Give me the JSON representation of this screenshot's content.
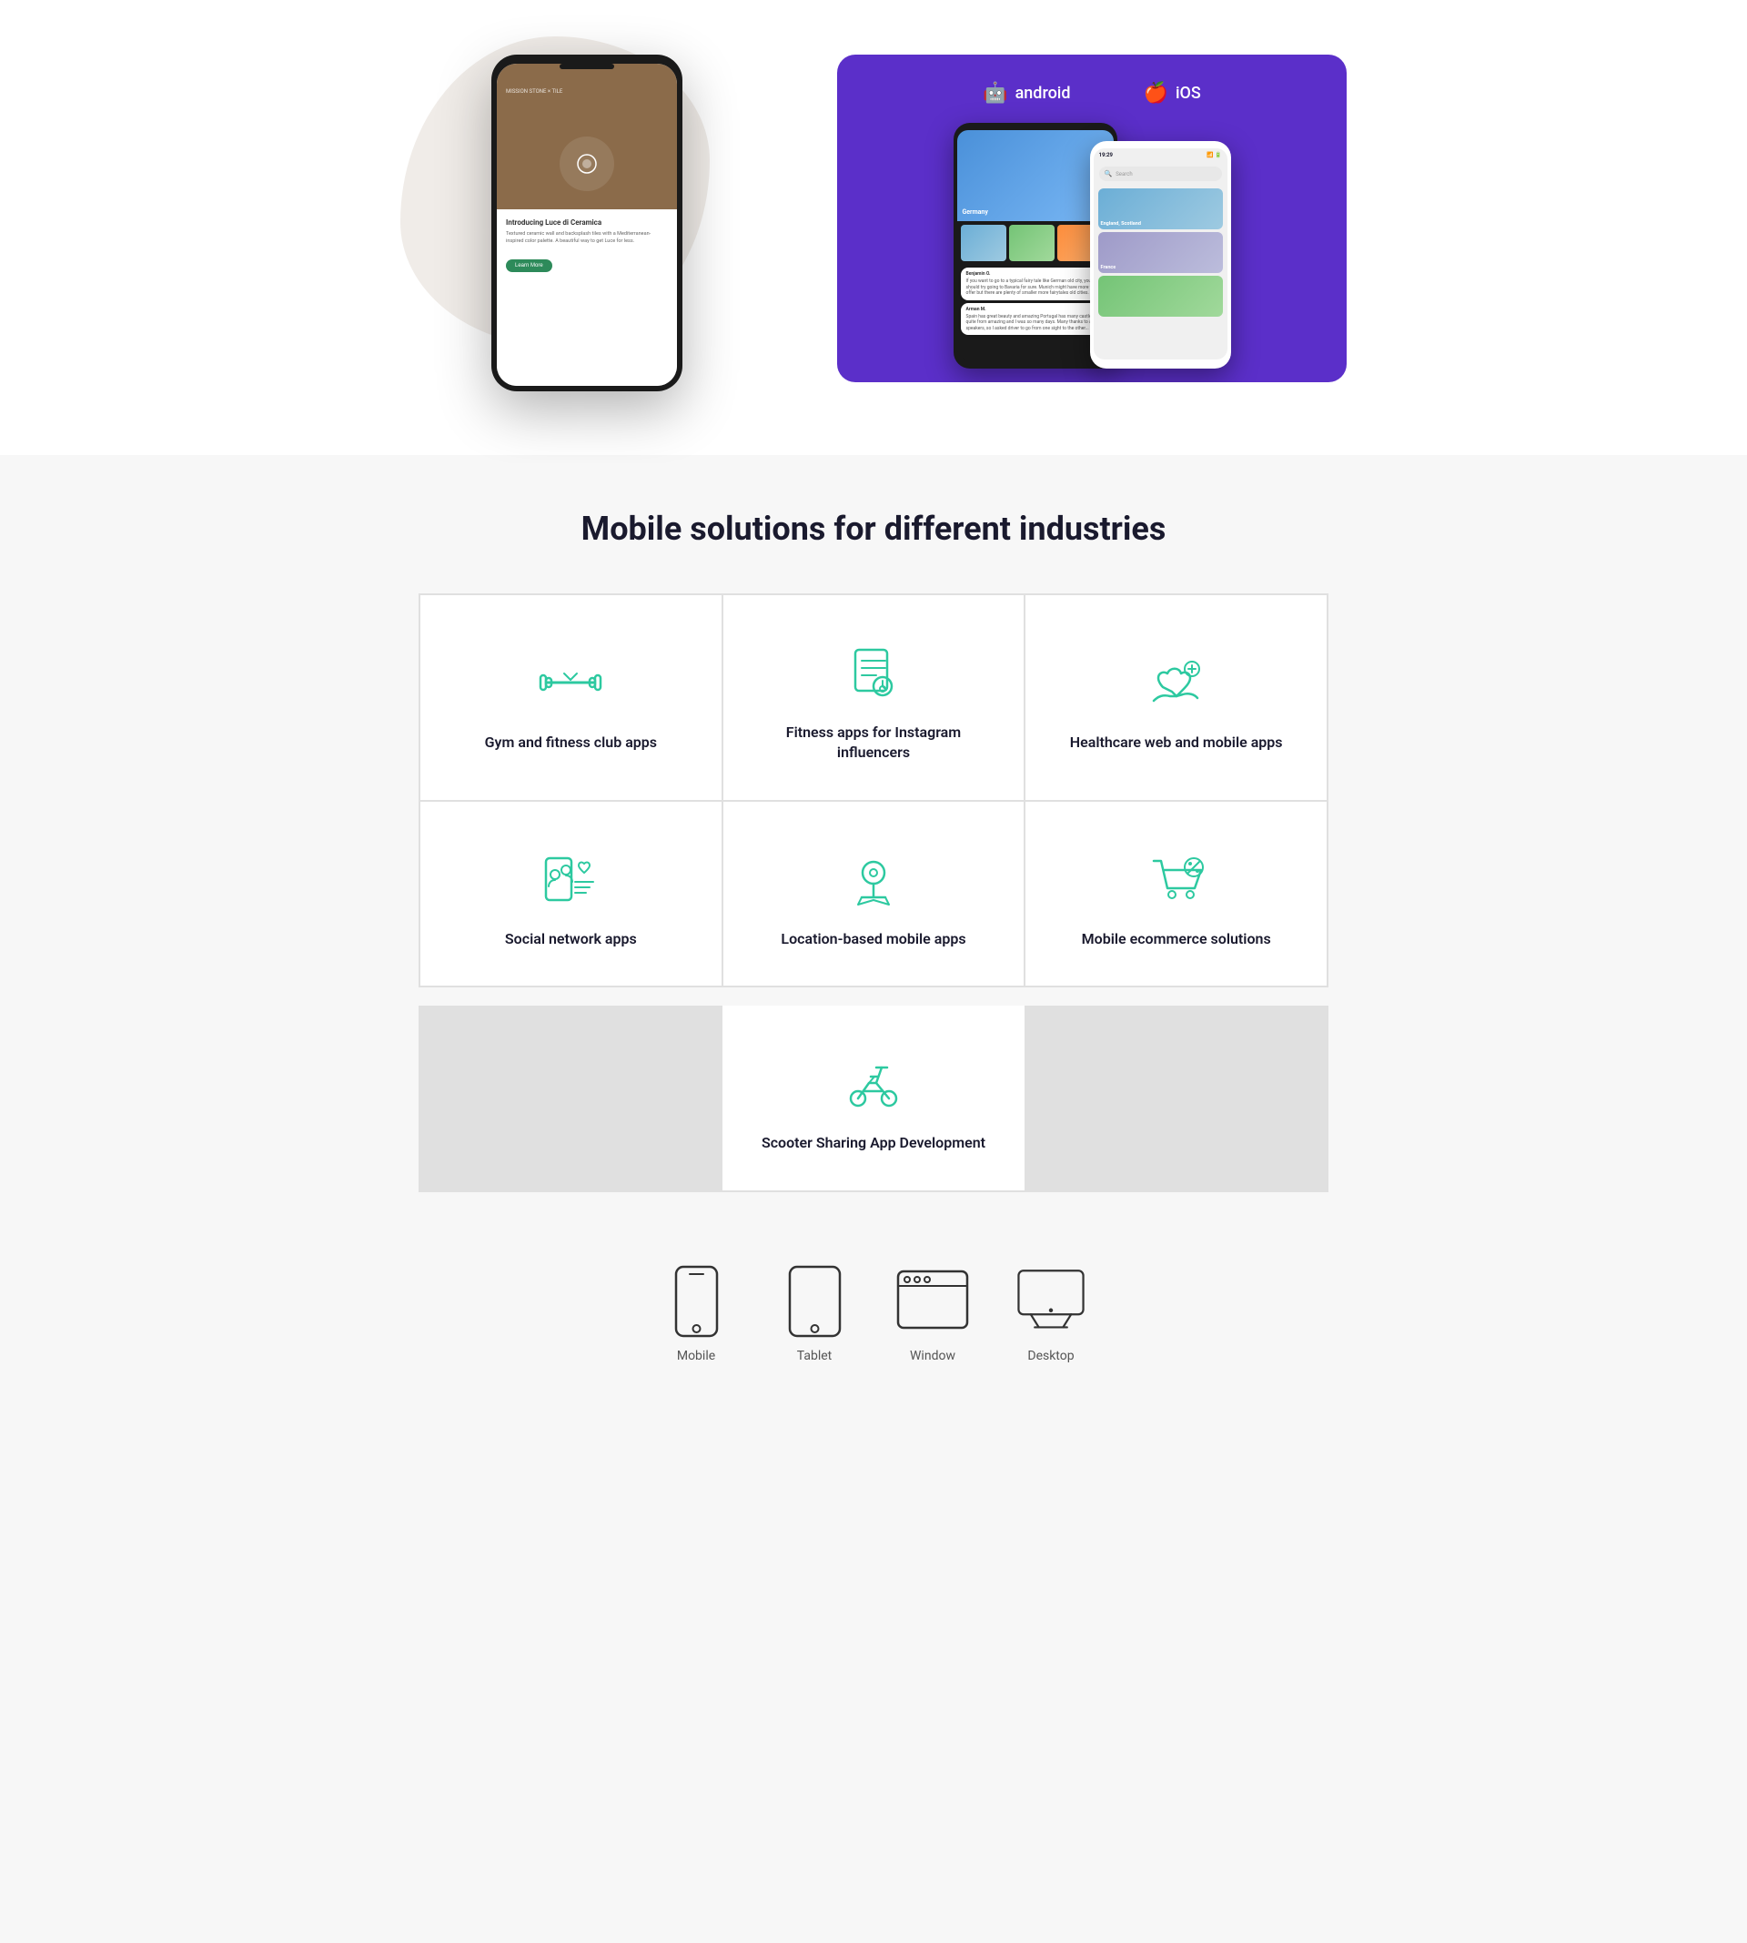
{
  "hero": {
    "phone_content_title": "Introducing Luce di Ceramica",
    "phone_content_text": "Textured ceramic wall and backsplash tiles with a Mediterranean-inspired color palette. A beautiful way to get Luce for less.",
    "phone_btn_label": "Learn More",
    "store_android_label": "android",
    "store_ios_label": "iOS",
    "img_germany": "Germany",
    "img_england": "England, Scotland",
    "img_france": "France"
  },
  "section": {
    "title": "Mobile solutions for different industries"
  },
  "services": [
    {
      "id": "gym",
      "label": "Gym and fitness club apps",
      "icon": "gym-icon"
    },
    {
      "id": "fitness-instagram",
      "label": "Fitness apps for Instagram influencers",
      "icon": "fitness-instagram-icon"
    },
    {
      "id": "healthcare",
      "label": "Healthcare web and mobile apps",
      "icon": "healthcare-icon"
    },
    {
      "id": "social",
      "label": "Social network apps",
      "icon": "social-icon"
    },
    {
      "id": "location",
      "label": "Location-based mobile apps",
      "icon": "location-icon"
    },
    {
      "id": "ecommerce",
      "label": "Mobile ecommerce solutions",
      "icon": "ecommerce-icon"
    }
  ],
  "service_scooter": {
    "id": "scooter",
    "label": "Scooter Sharing App Development",
    "icon": "scooter-icon"
  },
  "devices": [
    {
      "id": "mobile",
      "label": "Mobile",
      "icon": "mobile-device-icon"
    },
    {
      "id": "tablet",
      "label": "Tablet",
      "icon": "tablet-device-icon"
    },
    {
      "id": "window",
      "label": "Window",
      "icon": "window-device-icon"
    },
    {
      "id": "desktop",
      "label": "Desktop",
      "icon": "desktop-device-icon"
    }
  ]
}
